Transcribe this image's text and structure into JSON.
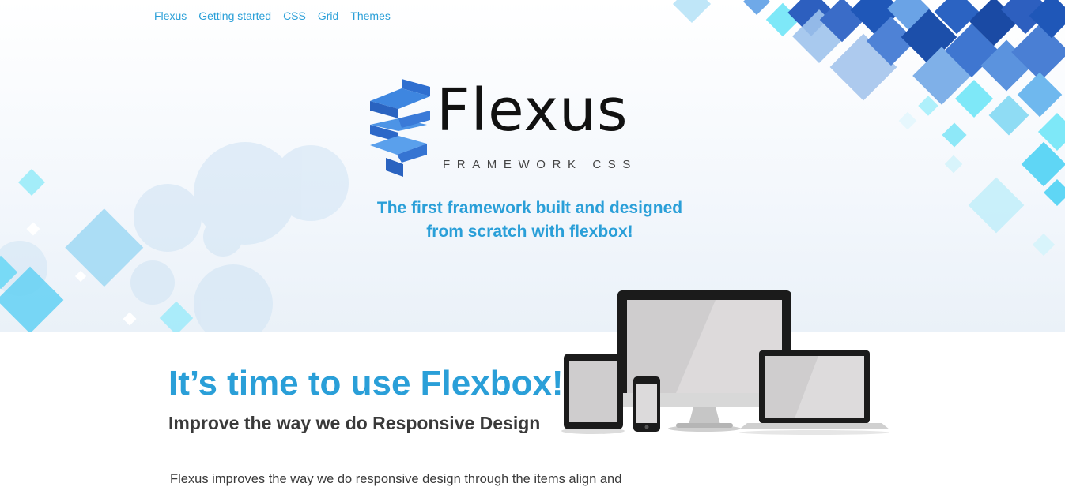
{
  "nav": {
    "items": [
      {
        "label": "Flexus"
      },
      {
        "label": "Getting started"
      },
      {
        "label": "CSS"
      },
      {
        "label": "Grid"
      },
      {
        "label": "Themes"
      }
    ]
  },
  "logo": {
    "wordmark": "Flexus",
    "subtitle": "FRAMEWORK CSS",
    "icon": "ribbon-logo-icon"
  },
  "hero": {
    "tagline_line1": "The first framework built and designed",
    "tagline_line2": "from scratch with flexbox!"
  },
  "intro": {
    "headline": "It’s time to use Flexbox!",
    "subheadline": "Improve the way we do Responsive Design",
    "paragraph": "Flexus improves the way we do responsive design through the items align and"
  },
  "illustration": {
    "icon": "responsive-devices-icon"
  },
  "colors": {
    "accent": "#2a9fd8",
    "text": "#3a3a3a",
    "heading": "#111111",
    "decor_dark": "#1f57b8",
    "decor_light": "#5fd6f5"
  }
}
